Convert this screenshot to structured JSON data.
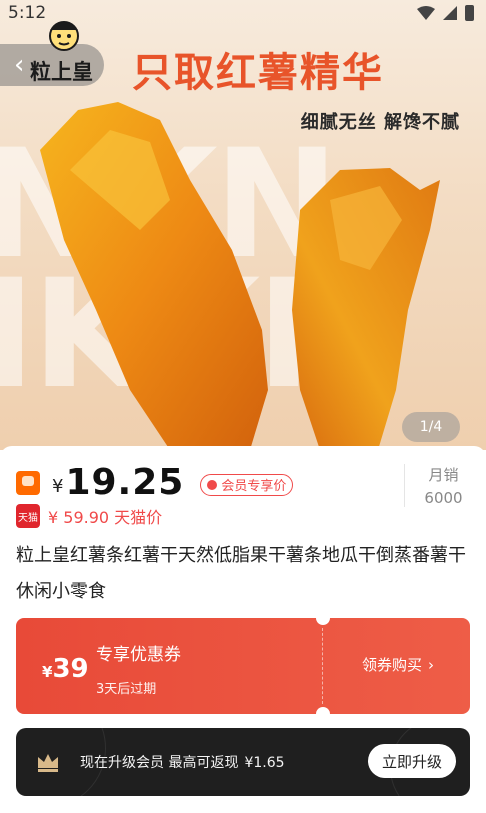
{
  "status_bar": {
    "time": "5:12"
  },
  "hero": {
    "brand_name": "粒上皇",
    "headline": "只取红薯精华",
    "subline": "细腻无丝 解馋不腻",
    "image_counter": "1/4"
  },
  "product": {
    "currency": "¥",
    "price": "19.25",
    "vip_badge": "会员专享价",
    "monthly_sales_label": "月销",
    "monthly_sales_value": "6000",
    "tmall_logo_text": "天猫",
    "tmall_price": "¥ 59.90 天猫价",
    "title": "粒上皇红薯条红薯干天然低脂果干薯条地瓜干倒蒸番薯干休闲小零食"
  },
  "coupon": {
    "currency": "¥",
    "amount": "39",
    "title": "专享优惠券",
    "expiry": "3天后过期",
    "claim_label": "领券购买",
    "claim_arrow": "›"
  },
  "vip_upgrade": {
    "text": "现在升级会员 最高可返现",
    "cashback": "¥1.65",
    "button_label": "立即升级"
  },
  "colors": {
    "accent_red": "#e84a38",
    "headline_orange": "#e8542a",
    "vip_bar_bg": "#1f1f1f"
  }
}
